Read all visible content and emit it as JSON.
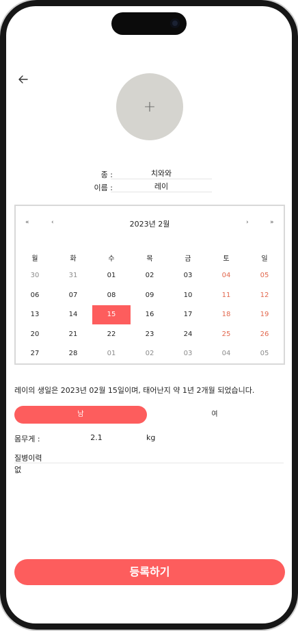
{
  "profile": {
    "add_photo_symbol": "+",
    "species_label": "종 :",
    "species_value": "치와와",
    "name_label": "이름 :",
    "name_value": "레이"
  },
  "calendar": {
    "prev_year": "«",
    "prev_month": "‹",
    "title": "2023년 2월",
    "next_month": "›",
    "next_year": "»",
    "weekdays": [
      "월",
      "화",
      "수",
      "목",
      "금",
      "토",
      "일"
    ],
    "weeks": [
      [
        "30",
        "31",
        "01",
        "02",
        "03",
        "04",
        "05"
      ],
      [
        "06",
        "07",
        "08",
        "09",
        "10",
        "11",
        "12"
      ],
      [
        "13",
        "14",
        "15",
        "16",
        "17",
        "18",
        "19"
      ],
      [
        "20",
        "21",
        "22",
        "23",
        "24",
        "25",
        "26"
      ],
      [
        "27",
        "28",
        "01",
        "02",
        "03",
        "04",
        "05"
      ]
    ],
    "selected": "15",
    "selected_color": "#fd5d5d",
    "weekend_color": "#e2674d"
  },
  "birth_info": "레이의 생일은 2023년 02월 15일이며, 태어난지 약 1년 2개월 되었습니다.",
  "gender": {
    "male": "남",
    "female": "여",
    "selected": "남"
  },
  "weight": {
    "label": "몸무게 :",
    "value": "2.1",
    "unit": "kg"
  },
  "history": {
    "label": "질병이력",
    "value": "없"
  },
  "submit_label": "등록하기",
  "accent_color": "#fd5d5d"
}
